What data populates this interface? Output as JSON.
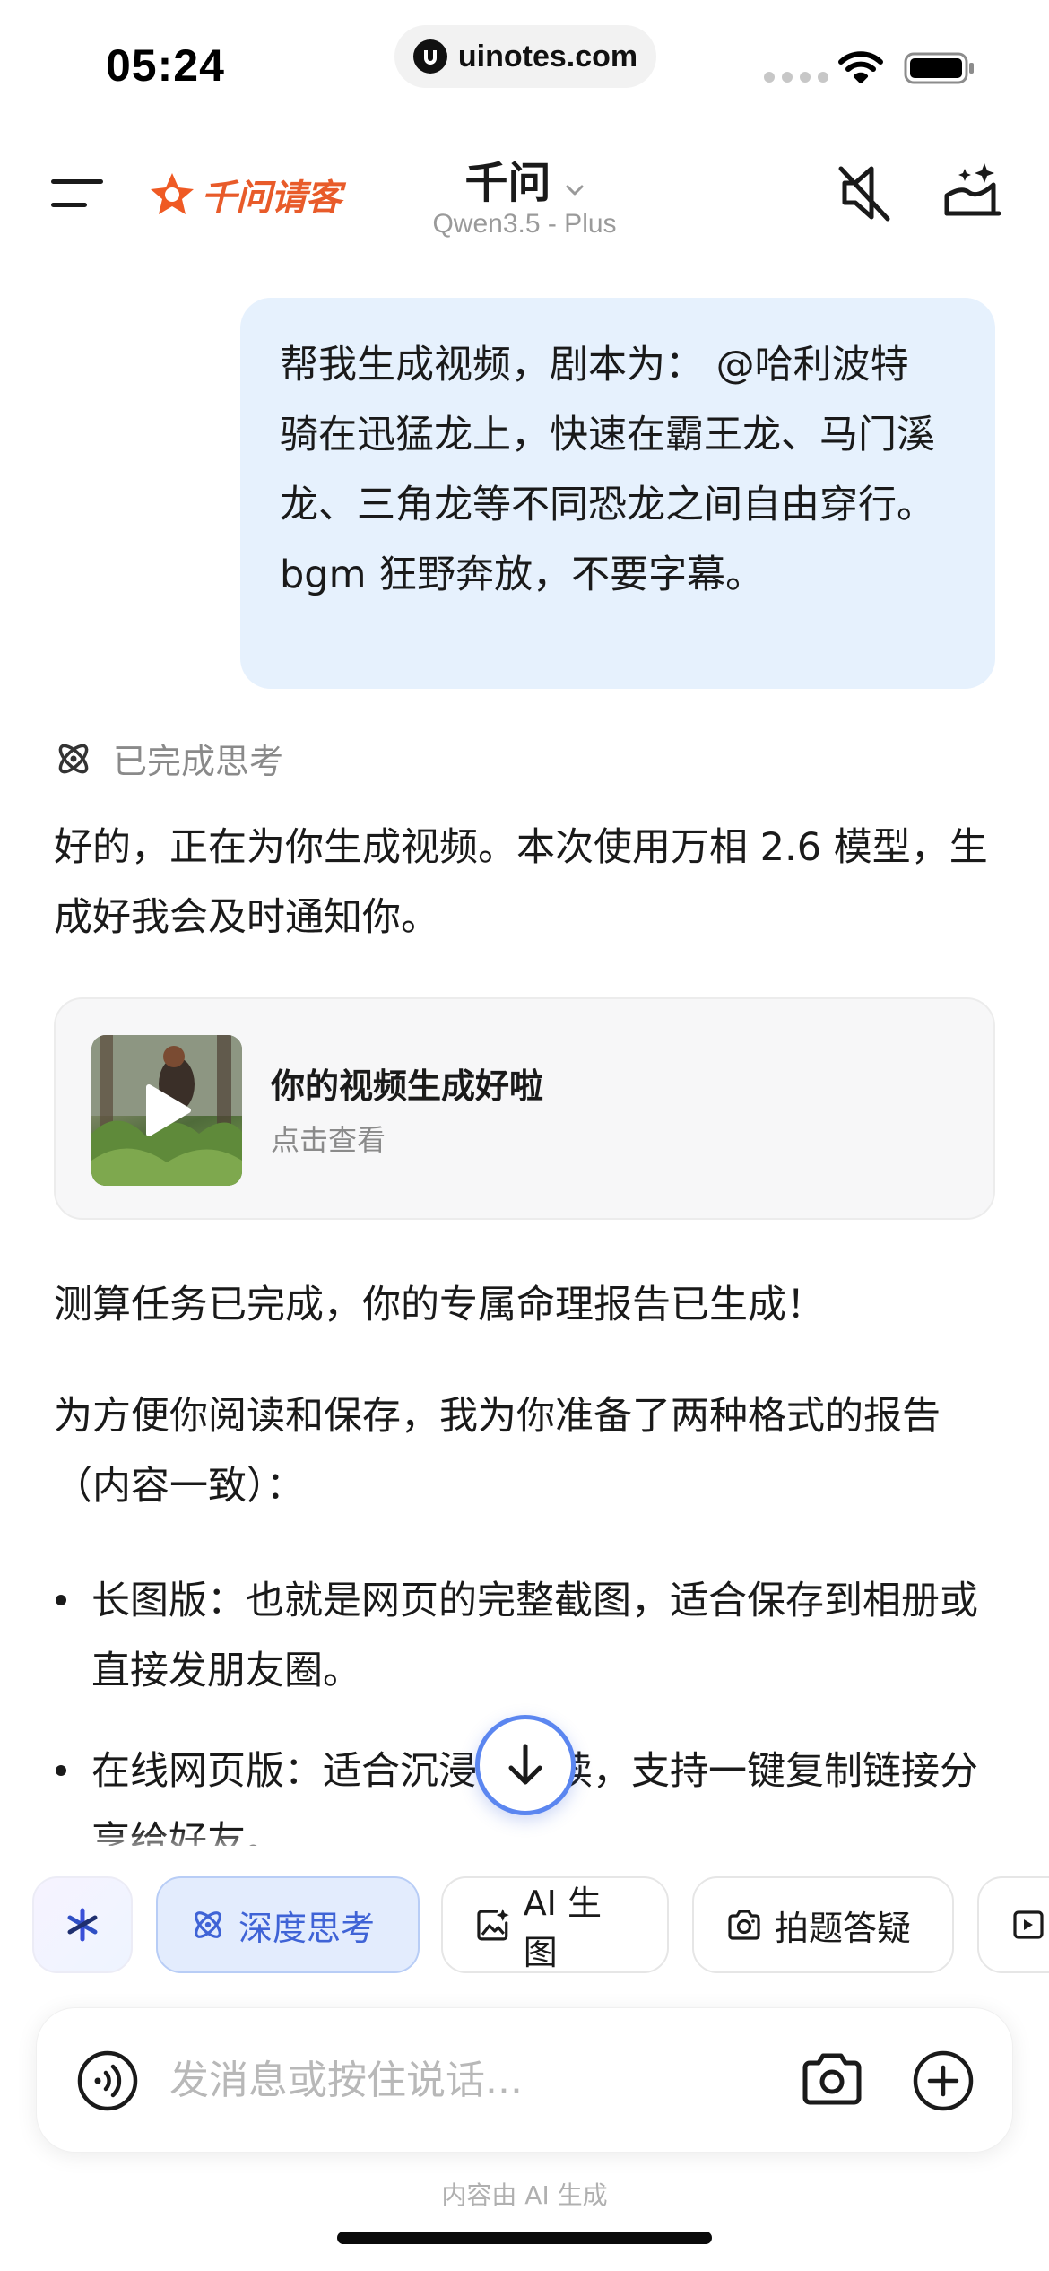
{
  "status_bar": {
    "time": "05:24",
    "url": "uinotes.com",
    "icons": [
      "signal-icon",
      "wifi-icon",
      "battery-icon"
    ]
  },
  "header": {
    "brand_logo_text": "千问请客",
    "title": "千问",
    "subtitle": "Qwen3.5 - Plus",
    "icons": [
      "menu-icon",
      "mute-icon",
      "new-chat-icon",
      "chevron-down-icon"
    ]
  },
  "chat": {
    "user_message": "帮我生成视频，剧本为： @哈利波特　骑在迅猛龙上，快速在霸王龙、马门溪龙、三角龙等不同恐龙之间自由穿行。bgm 狂野奔放，不要字幕。",
    "thinking_label": "已完成思考",
    "reply_1": "好的，正在为你生成视频。本次使用万相 2.6 模型，生成好我会及时通知你。",
    "video_card": {
      "title": "你的视频生成好啦",
      "subtitle": "点击查看"
    },
    "reply_2": "测算任务已完成，你的专属命理报告已生成！",
    "reply_3": "为方便你阅读和保存，我为你准备了两种格式的报告（内容一致）：",
    "bullets": [
      "长图版：也就是网页的完整截图，适合保存到相册或直接发朋友圈。",
      "在线网页版：适合沉浸式阅读，支持一键复制链接分享给好友。"
    ]
  },
  "chips": {
    "deep_think": "深度思考",
    "ai_image": "AI 生图",
    "photo_qa": "拍题答疑"
  },
  "input": {
    "placeholder": "发消息或按住说话..."
  },
  "footnote": "内容由 AI 生成",
  "colors": {
    "brand_orange": "#e85b2a",
    "user_bubble": "#e6f1fd",
    "accent_blue": "#3f63d6",
    "scroll_ring": "#5b86f0"
  }
}
